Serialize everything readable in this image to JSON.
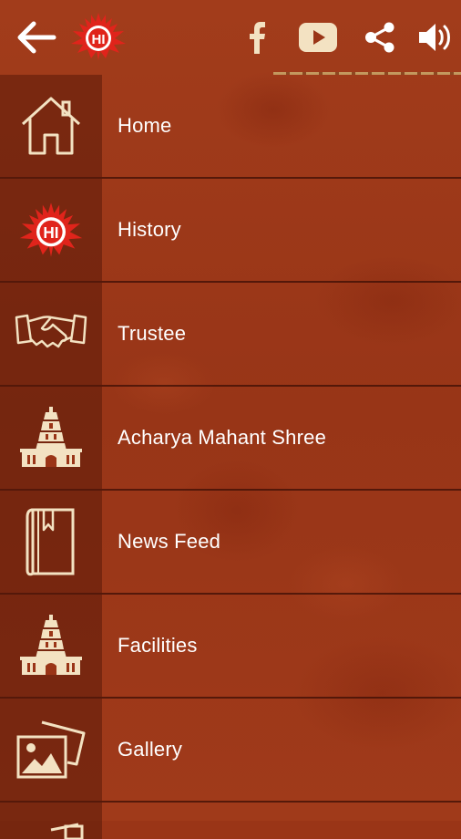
{
  "topbar": {
    "icons": [
      "back-arrow-icon",
      "temple-logo-icon",
      "facebook-icon",
      "youtube-icon",
      "share-icon",
      "volume-icon"
    ]
  },
  "menu": {
    "items": [
      {
        "label": "Home",
        "icon": "home-icon"
      },
      {
        "label": "History",
        "icon": "temple-logo-icon"
      },
      {
        "label": "Trustee",
        "icon": "handshake-icon"
      },
      {
        "label": "Acharya Mahant Shree",
        "icon": "temple-tower-icon"
      },
      {
        "label": "News Feed",
        "icon": "book-icon"
      },
      {
        "label": "Facilities",
        "icon": "temple-tower-icon"
      },
      {
        "label": "Gallery",
        "icon": "gallery-icon"
      }
    ]
  },
  "colors": {
    "background": "#9a3517",
    "icon_cream": "#f3e2c2",
    "logo_red": "#e0241b",
    "text": "#ffffff"
  }
}
